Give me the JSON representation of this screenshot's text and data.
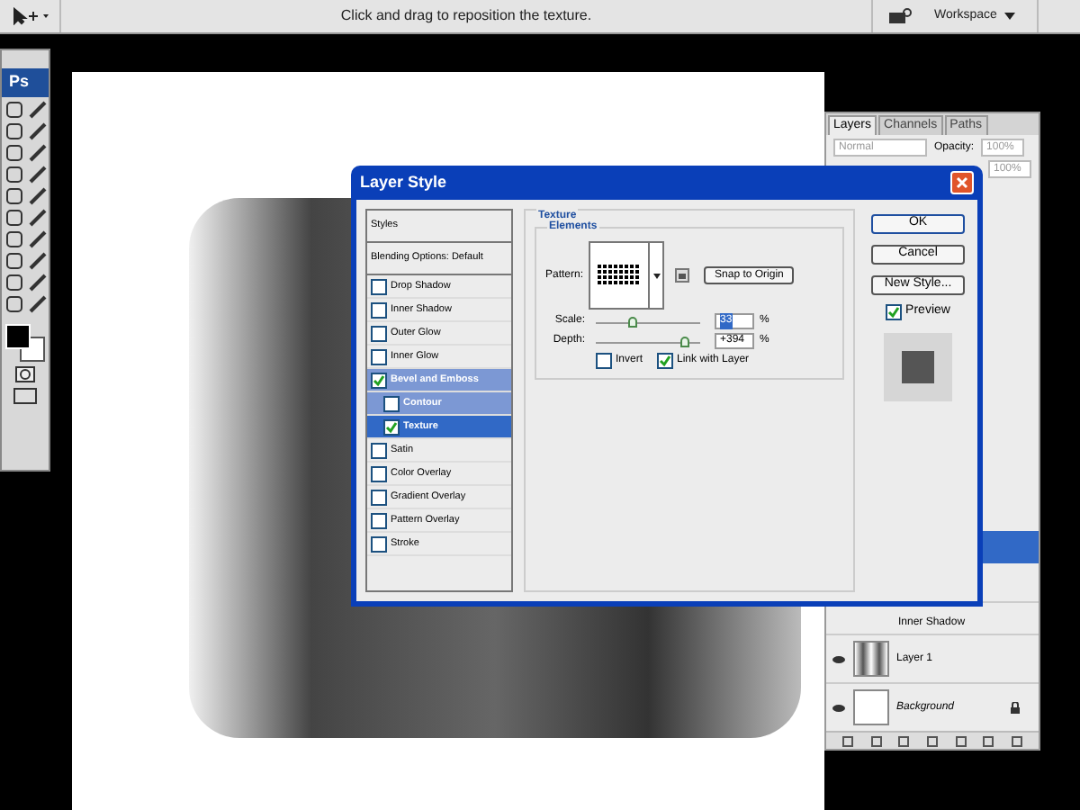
{
  "options_bar": {
    "hint": "Click and drag to reposition the texture.",
    "workspace": "Workspace"
  },
  "toolbox": {
    "logo": "Ps"
  },
  "dialog": {
    "title": "Layer Style",
    "styles": [
      {
        "label": "Styles",
        "kind": "header"
      },
      {
        "label": "Blending Options: Default",
        "kind": "header"
      },
      {
        "label": "Drop Shadow",
        "kind": "check",
        "checked": false,
        "selected": false
      },
      {
        "label": "Inner Shadow",
        "kind": "check",
        "checked": false,
        "selected": false
      },
      {
        "label": "Outer Glow",
        "kind": "check",
        "checked": false,
        "selected": false
      },
      {
        "label": "Inner Glow",
        "kind": "check",
        "checked": false,
        "selected": false
      },
      {
        "label": "Bevel and Emboss",
        "kind": "check",
        "checked": true,
        "selected": false,
        "children": [
          {
            "label": "Contour",
            "checked": false,
            "selected": false
          },
          {
            "label": "Texture",
            "checked": true,
            "selected": true
          }
        ]
      },
      {
        "label": "Satin",
        "kind": "check",
        "checked": false,
        "selected": false
      },
      {
        "label": "Color Overlay",
        "kind": "check",
        "checked": false,
        "selected": false
      },
      {
        "label": "Gradient Overlay",
        "kind": "check",
        "checked": false,
        "selected": false
      },
      {
        "label": "Pattern Overlay",
        "kind": "check",
        "checked": false,
        "selected": false
      },
      {
        "label": "Stroke",
        "kind": "check",
        "checked": false,
        "selected": false
      }
    ],
    "texture": {
      "section": "Texture",
      "group": "Elements",
      "pattern_label": "Pattern:",
      "snap_button": "Snap to Origin",
      "sliders": [
        {
          "label": "Scale:",
          "level": 0.35,
          "value": "33",
          "unit": "%",
          "selected": true
        },
        {
          "label": "Depth:",
          "level": 0.85,
          "value": "+394",
          "unit": "%",
          "selected": false
        }
      ],
      "invert": {
        "label": "Invert",
        "checked": false
      },
      "link": {
        "label": "Link with Layer",
        "checked": true
      }
    },
    "buttons": [
      "OK",
      "Cancel",
      "New Style..."
    ],
    "preview": {
      "label": "Preview",
      "checked": true
    }
  },
  "layers_panel": {
    "tabs": [
      {
        "label": "Layers",
        "selected": true
      },
      {
        "label": "Channels",
        "selected": false
      },
      {
        "label": "Paths",
        "selected": false
      }
    ],
    "blend_mode": "Normal",
    "opacity_label": "Opacity:",
    "opacity": "100%",
    "fill": "100%",
    "layers": [
      {
        "name": "Inner Shadow",
        "kind": "effect"
      },
      {
        "name": "Layer 1",
        "kind": "layer"
      },
      {
        "name": "Background",
        "kind": "background"
      }
    ]
  }
}
